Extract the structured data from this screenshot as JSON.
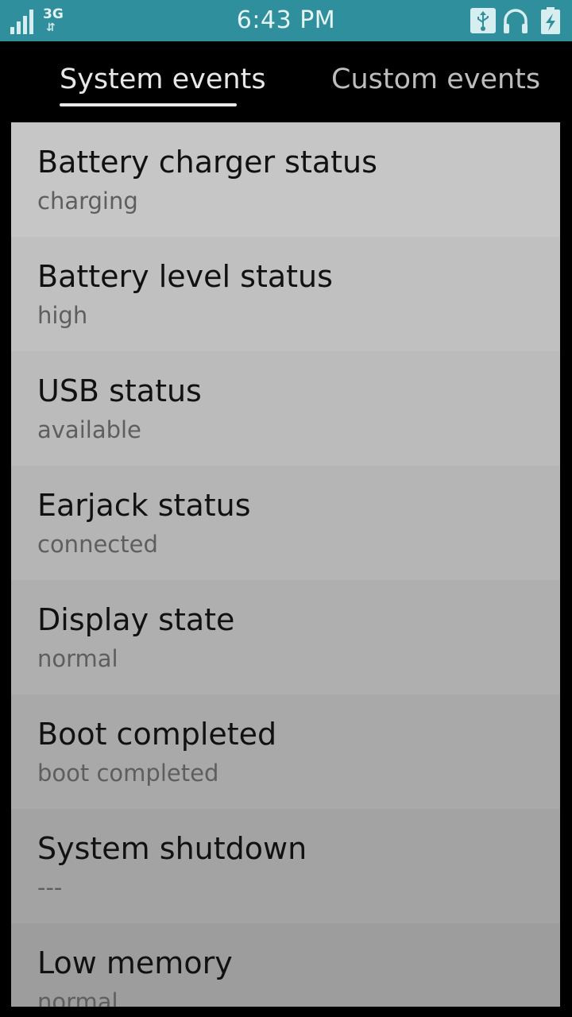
{
  "status_bar": {
    "time": "6:43 PM",
    "network": "3G",
    "icons": [
      "signal-icon",
      "usb-icon",
      "headphones-icon",
      "battery-charging-icon"
    ]
  },
  "tabs": [
    {
      "label": "System events",
      "active": true
    },
    {
      "label": "Custom events",
      "active": false
    }
  ],
  "events": [
    {
      "title": "Battery charger status",
      "value": "charging",
      "bg": "#c6c6c6"
    },
    {
      "title": "Battery level status",
      "value": "high",
      "bg": "#c0c0c0"
    },
    {
      "title": "USB status",
      "value": "available",
      "bg": "#bbbbbb"
    },
    {
      "title": "Earjack status",
      "value": "connected",
      "bg": "#b5b5b5"
    },
    {
      "title": "Display state",
      "value": "normal",
      "bg": "#afafaf"
    },
    {
      "title": "Boot completed",
      "value": "boot completed",
      "bg": "#a9a9a9"
    },
    {
      "title": "System shutdown",
      "value": "---",
      "bg": "#a3a3a3"
    },
    {
      "title": "Low memory",
      "value": "normal",
      "bg": "#9d9d9d"
    }
  ],
  "colors": {
    "status_bar": "#2f8f9c",
    "background": "#000000"
  }
}
